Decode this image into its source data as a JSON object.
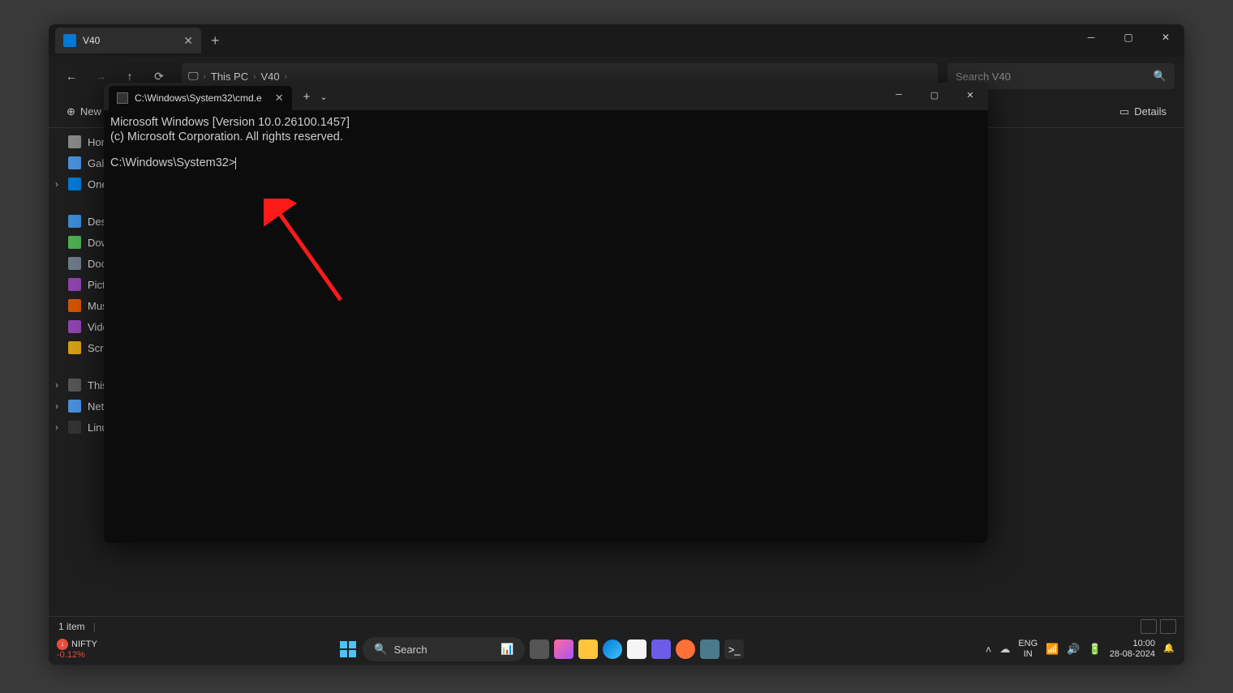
{
  "explorer": {
    "tab_title": "V40",
    "breadcrumbs": [
      "This PC",
      "V40"
    ],
    "search_placeholder": "Search V40",
    "toolbar_new": "New",
    "toolbar_details": "Details",
    "status": "1 item",
    "sidebar": {
      "home": "Home",
      "gallery": "Gallery",
      "onedrive": "OneDrive",
      "desktop": "Desktop",
      "downloads": "Downloads",
      "documents": "Documents",
      "pictures": "Pictures",
      "music": "Music",
      "videos": "Videos",
      "screenshots": "Screenshots",
      "this_pc": "This PC",
      "network": "Network",
      "linux": "Linux"
    }
  },
  "terminal": {
    "tab_title": "C:\\Windows\\System32\\cmd.e",
    "line1": "Microsoft Windows [Version 10.0.26100.1457]",
    "line2": "(c) Microsoft Corporation. All rights reserved.",
    "prompt": "C:\\Windows\\System32>"
  },
  "taskbar": {
    "stock_name": "NIFTY",
    "stock_change": "-0.12%",
    "search": "Search",
    "lang1": "ENG",
    "lang2": "IN",
    "time": "10:00",
    "date": "28-08-2024"
  }
}
